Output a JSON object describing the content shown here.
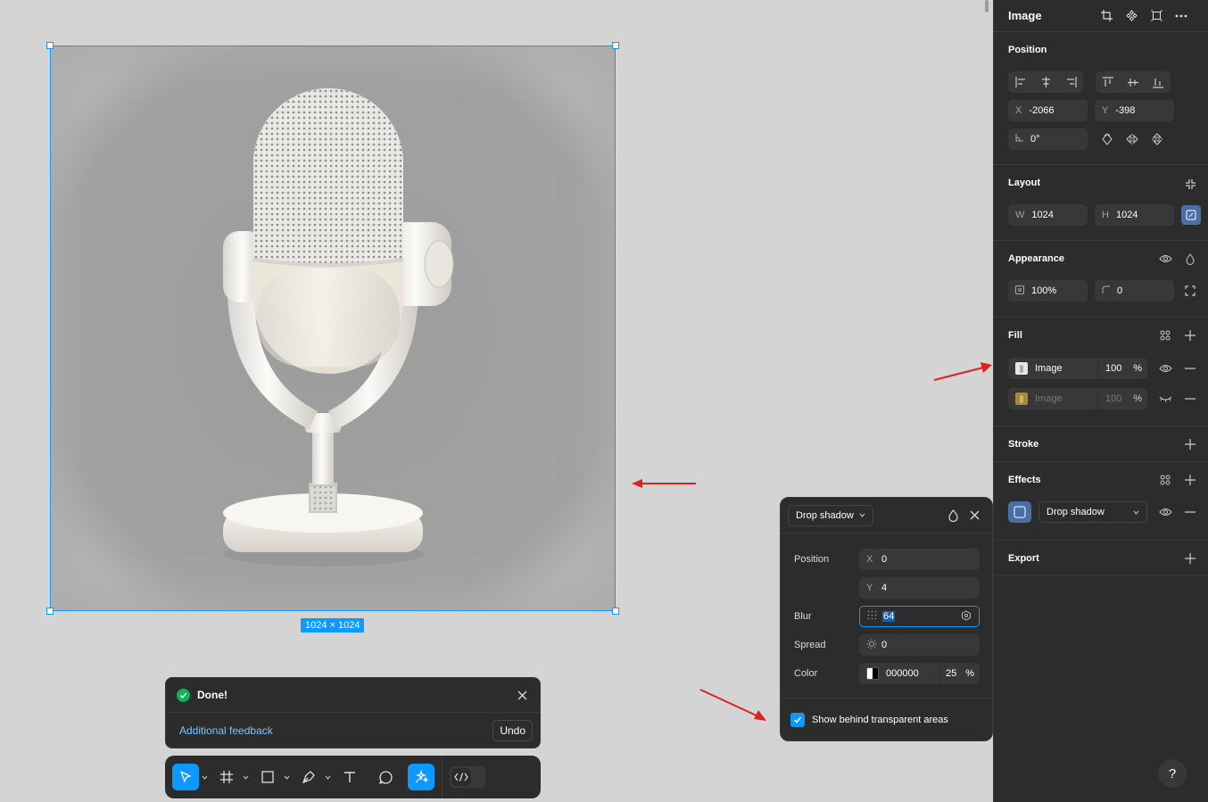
{
  "canvas": {
    "dimension_badge": "1024 × 1024",
    "image_alt": "Microphone"
  },
  "toast": {
    "title": "Done!",
    "feedback_link": "Additional feedback",
    "undo_label": "Undo"
  },
  "toolbar": {
    "tools": [
      "move-tool",
      "frame-tool",
      "shape-tool",
      "pen-tool",
      "text-tool",
      "comment-tool",
      "actions-tool",
      "dev-mode-toggle"
    ]
  },
  "drop_shadow_popover": {
    "type_label": "Drop shadow",
    "position_label": "Position",
    "x_prefix": "X",
    "x_value": "0",
    "y_prefix": "Y",
    "y_value": "4",
    "blur_label": "Blur",
    "blur_value": "64",
    "spread_label": "Spread",
    "spread_value": "0",
    "color_label": "Color",
    "color_hex": "000000",
    "color_opacity": "25",
    "percent": "%",
    "show_behind_label": "Show behind transparent areas",
    "show_behind_checked": true
  },
  "panel": {
    "title": "Image",
    "position": {
      "title": "Position",
      "x_prefix": "X",
      "x_value": "-2066",
      "y_prefix": "Y",
      "y_value": "-398",
      "rotation_value": "0°"
    },
    "layout": {
      "title": "Layout",
      "w_prefix": "W",
      "w_value": "1024",
      "h_prefix": "H",
      "h_value": "1024"
    },
    "appearance": {
      "title": "Appearance",
      "opacity_value": "100%",
      "radius_value": "0"
    },
    "fill": {
      "title": "Fill",
      "items": [
        {
          "label": "Image",
          "opacity": "100",
          "unit": "%",
          "visible": true
        },
        {
          "label": "Image",
          "opacity": "100",
          "unit": "%",
          "visible": false
        }
      ]
    },
    "stroke": {
      "title": "Stroke"
    },
    "effects": {
      "title": "Effects",
      "effect_label": "Drop shadow"
    },
    "export": {
      "title": "Export"
    },
    "help_label": "?"
  },
  "colors": {
    "accent": "#0d99ff",
    "panel_bg": "#2c2c2c",
    "canvas_bg": "#d4d4d4",
    "annotation_arrow": "#e02020",
    "success": "#14ae5c"
  }
}
